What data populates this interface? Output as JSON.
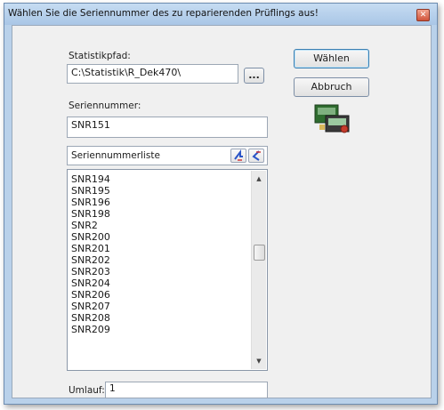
{
  "window": {
    "title": "Wählen Sie die Seriennummer des zu reparierenden Prüflings aus!",
    "close_glyph": "✕"
  },
  "form": {
    "statistikpfad_label": "Statistikpfad:",
    "statistikpfad_value": "C:\\Statistik\\R_Dek470\\",
    "browse_label": "...",
    "seriennummer_label": "Seriennummer:",
    "seriennummer_value": "SNR151",
    "list_header": "Seriennummerliste",
    "umlauf_label": "Umlauf:",
    "umlauf_value": "1"
  },
  "buttons": {
    "choose": "Wählen",
    "cancel": "Abbruch"
  },
  "list": {
    "items": [
      "SNR194",
      "SNR195",
      "SNR196",
      "SNR198",
      "SNR2",
      "SNR200",
      "SNR201",
      "SNR202",
      "SNR203",
      "SNR204",
      "SNR206",
      "SNR207",
      "SNR208",
      "SNR209"
    ]
  },
  "icons": {
    "sort_ascending": "sort-up-icon",
    "sort_descending": "sort-down-icon",
    "app": "test-device-icon"
  },
  "colors": {
    "title_bar": "#b9d1ea",
    "client_bg": "#f0f0f0",
    "accent": "#3c7fb1"
  }
}
